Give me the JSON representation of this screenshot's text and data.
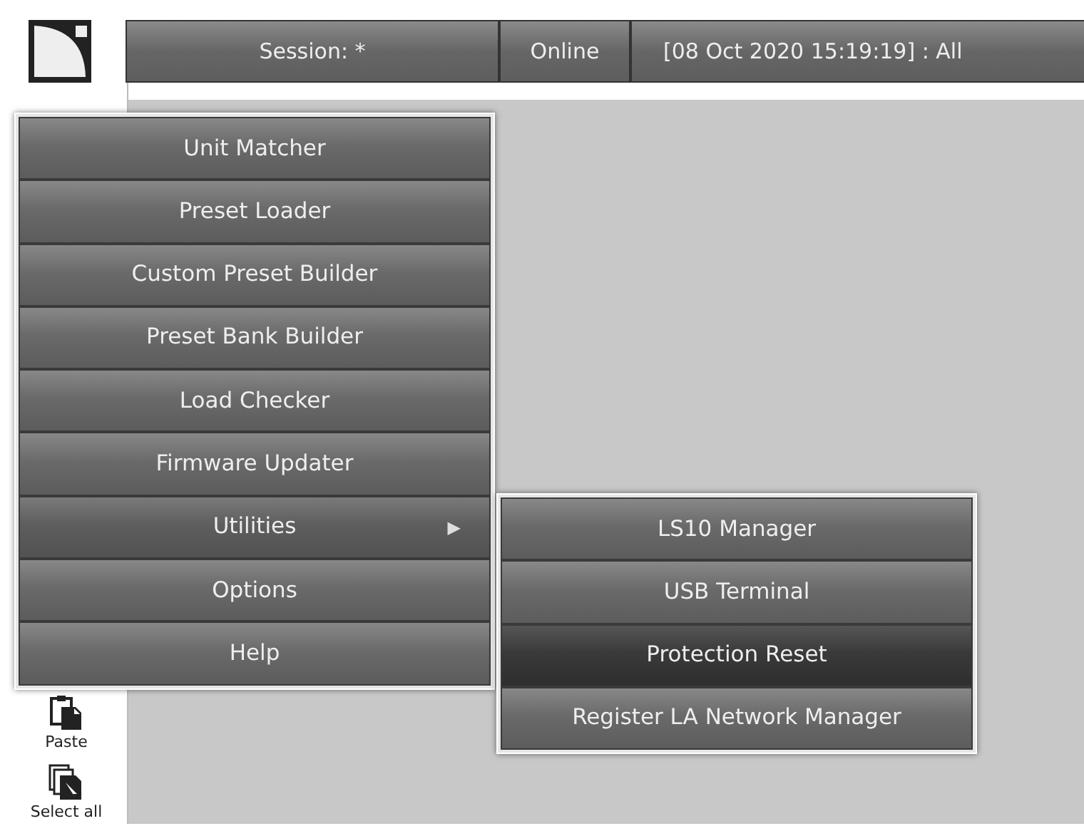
{
  "toolbar": {
    "session": "Session: *",
    "status": "Online",
    "log": "[08 Oct 2020 15:19:19] : All"
  },
  "menu": {
    "items": [
      {
        "label": "Unit Matcher",
        "kind": "item",
        "selected": false
      },
      {
        "label": "Preset Loader",
        "kind": "item",
        "selected": false
      },
      {
        "label": "Custom Preset Builder",
        "kind": "item",
        "selected": false
      },
      {
        "label": "Preset Bank Builder",
        "kind": "item",
        "selected": false
      },
      {
        "label": "Load Checker",
        "kind": "item",
        "selected": false
      },
      {
        "label": "Firmware Updater",
        "kind": "item",
        "selected": false
      },
      {
        "label": "Utilities",
        "kind": "submenu",
        "arrow": "▶",
        "selected": false,
        "expanded": true
      },
      {
        "label": "Options",
        "kind": "item",
        "selected": false
      },
      {
        "label": "Help",
        "kind": "item",
        "selected": false
      }
    ]
  },
  "submenu": {
    "items": [
      {
        "label": "LS10 Manager",
        "selected": false
      },
      {
        "label": "USB Terminal",
        "selected": false
      },
      {
        "label": "Protection Reset",
        "selected": true
      },
      {
        "label": "Register LA Network Manager",
        "selected": false
      }
    ]
  },
  "sidebar": {
    "items": [
      {
        "label": "Paste",
        "kind": "paste"
      },
      {
        "label": "Select all",
        "kind": "select"
      }
    ]
  }
}
